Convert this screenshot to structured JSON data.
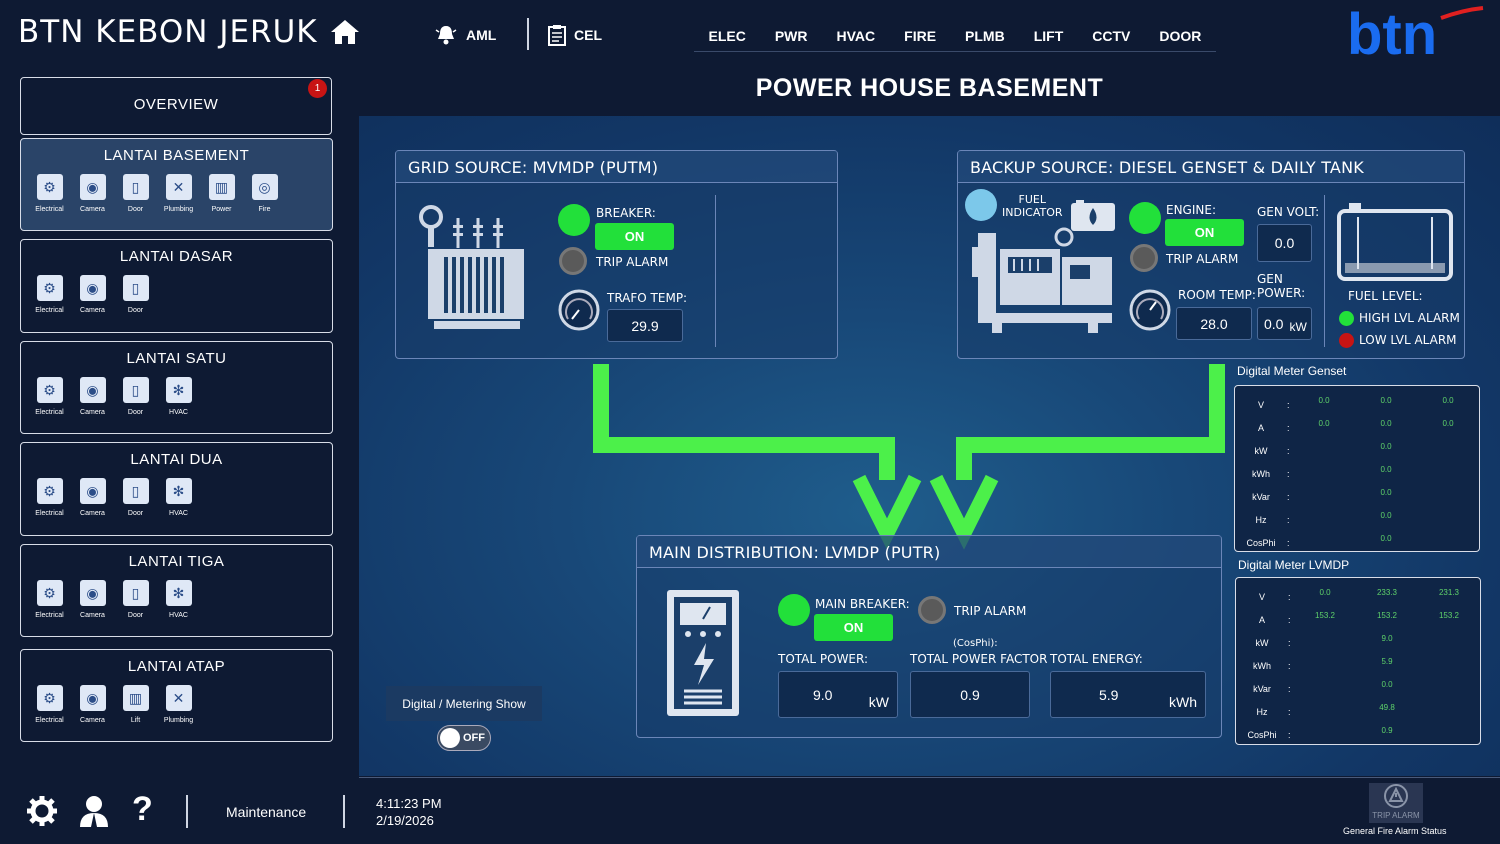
{
  "header": {
    "site_title": "BTN KEBON JERUK",
    "aml_label": "AML",
    "cel_label": "CEL",
    "categories": [
      "ELEC",
      "PWR",
      "HVAC",
      "FIRE",
      "PLMB",
      "LIFT",
      "CCTV",
      "DOOR"
    ],
    "logo_text": "btn"
  },
  "page_title": "POWER HOUSE BASEMENT",
  "sidebar": {
    "overview": {
      "label": "OVERVIEW",
      "badge": "1"
    },
    "floors": [
      {
        "name": "LANTAI BASEMENT",
        "items": [
          "Electrical",
          "Camera",
          "Door",
          "Plumbing",
          "Power",
          "Fire"
        ]
      },
      {
        "name": "LANTAI DASAR",
        "items": [
          "Electrical",
          "Camera",
          "Door"
        ]
      },
      {
        "name": "LANTAI SATU",
        "items": [
          "Electrical",
          "Camera",
          "Door",
          "HVAC"
        ]
      },
      {
        "name": "LANTAI DUA",
        "items": [
          "Electrical",
          "Camera",
          "Door",
          "HVAC"
        ]
      },
      {
        "name": "LANTAI TIGA",
        "items": [
          "Electrical",
          "Camera",
          "Door",
          "HVAC"
        ]
      },
      {
        "name": "LANTAI ATAP",
        "items": [
          "Electrical",
          "Camera",
          "Lift",
          "Plumbing"
        ]
      }
    ]
  },
  "grid": {
    "title": "GRID SOURCE: MVMDP (PUTM)",
    "breaker_label": "BREAKER:",
    "breaker_state": "ON",
    "trip_label": "TRIP ALARM",
    "temp_label": "TRAFO TEMP:",
    "temp_value": "29.9"
  },
  "backup": {
    "title": "BACKUP SOURCE: DIESEL GENSET & DAILY TANK",
    "fuel_indicator": "FUEL\nINDICATOR",
    "engine_label": "ENGINE:",
    "engine_state": "ON",
    "trip_label": "TRIP ALARM",
    "room_temp_label": "ROOM TEMP:",
    "room_temp_value": "28.0",
    "gen_volt_label": "GEN VOLT:",
    "gen_volt_value": "0.0",
    "gen_power_label": "GEN\nPOWER:",
    "gen_power_value": "0.0",
    "gen_power_unit": "kW",
    "fuel_level_label": "FUEL LEVEL:",
    "high_alarm": "HIGH LVL ALARM",
    "low_alarm": "LOW LVL ALARM"
  },
  "main": {
    "title": "MAIN DISTRIBUTION: LVMDP (PUTR)",
    "breaker_label": "MAIN BREAKER:",
    "breaker_state": "ON",
    "trip_label": "TRIP ALARM",
    "power_label": "TOTAL POWER:",
    "power_value": "9.0",
    "power_unit": "kW",
    "pf_sub": "(CosPhi):",
    "pf_label": "TOTAL POWER FACTOR",
    "pf_value": "0.9",
    "energy_label": "TOTAL ENERGY:",
    "energy_value": "5.9",
    "energy_unit": "kWh"
  },
  "metering": {
    "label": "Digital / Metering Show",
    "toggle": "OFF"
  },
  "meter_genset": {
    "title": "Digital Meter Genset",
    "rows": [
      {
        "k": "V",
        "v": [
          "0.0",
          "0.0",
          "0.0"
        ]
      },
      {
        "k": "A",
        "v": [
          "0.0",
          "0.0",
          "0.0"
        ]
      },
      {
        "k": "kW",
        "v": [
          "",
          "0.0",
          ""
        ]
      },
      {
        "k": "kWh",
        "v": [
          "",
          "0.0",
          ""
        ]
      },
      {
        "k": "kVar",
        "v": [
          "",
          "0.0",
          ""
        ]
      },
      {
        "k": "Hz",
        "v": [
          "",
          "0.0",
          ""
        ]
      },
      {
        "k": "CosPhi",
        "v": [
          "",
          "0.0",
          ""
        ]
      }
    ]
  },
  "meter_lvmdp": {
    "title": "Digital Meter LVMDP",
    "rows": [
      {
        "k": "V",
        "v": [
          "0.0",
          "233.3",
          "231.3"
        ]
      },
      {
        "k": "A",
        "v": [
          "153.2",
          "153.2",
          "153.2"
        ]
      },
      {
        "k": "kW",
        "v": [
          "",
          "9.0",
          ""
        ]
      },
      {
        "k": "kWh",
        "v": [
          "",
          "5.9",
          ""
        ]
      },
      {
        "k": "kVar",
        "v": [
          "",
          "0.0",
          ""
        ]
      },
      {
        "k": "Hz",
        "v": [
          "",
          "49.8",
          ""
        ]
      },
      {
        "k": "CosPhi",
        "v": [
          "",
          "0.9",
          ""
        ]
      }
    ]
  },
  "footer": {
    "maintenance": "Maintenance",
    "time": "4:11:23 PM",
    "date": "2/19/2026",
    "trip_alarm": "TRIP ALARM",
    "fire_status": "General Fire Alarm Status"
  },
  "colors": {
    "on": "#22e03a",
    "alarm_red": "#c81414",
    "arrow": "#4cf04a"
  }
}
